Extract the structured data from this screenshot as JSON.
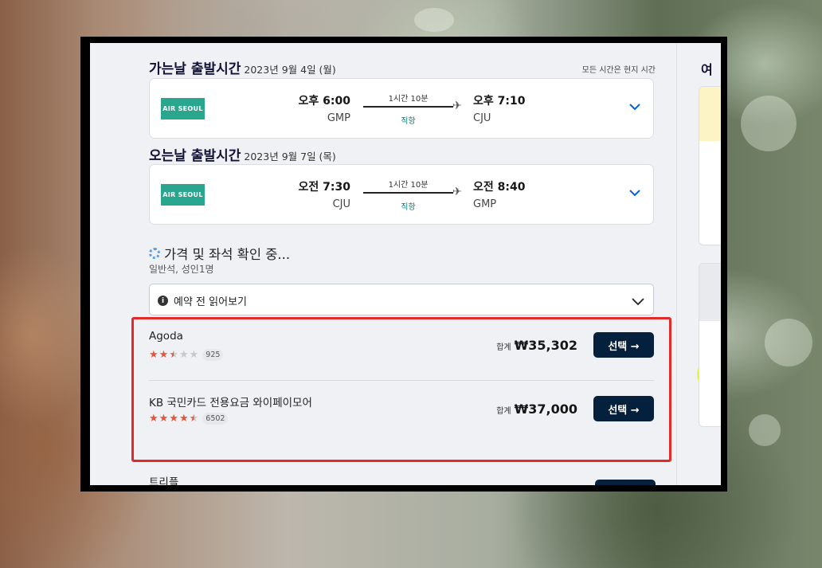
{
  "outbound": {
    "title": "가는날 출발시간",
    "date": "2023년 9월 4일 (월)",
    "note": "모든 시간은 현지 시간",
    "airline": "AIR SEOUL",
    "dep_time": "오후 6:00",
    "dep_code": "GMP",
    "arr_time": "오후 7:10",
    "arr_code": "CJU",
    "duration": "1시간 10분",
    "stops": "직항"
  },
  "inbound": {
    "title": "오는날 출발시간",
    "date": "2023년 9월 7일 (목)",
    "airline": "AIR SEOUL",
    "dep_time": "오전 7:30",
    "dep_code": "CJU",
    "arr_time": "오전 8:40",
    "arr_code": "GMP",
    "duration": "1시간 10분",
    "stops": "직항"
  },
  "status": {
    "loading": "가격 및 좌석 확인 중...",
    "cabin": "일반석, 성인1명"
  },
  "read_before": {
    "label": "예약 전 읽어보기"
  },
  "providers": [
    {
      "name": "Agoda",
      "rating": 2.5,
      "reviews": "925",
      "price_label": "합계",
      "price": "₩35,302",
      "button": "선택 →"
    },
    {
      "name": "KB 국민카드 전용요금 와이페이모어",
      "rating": 4.5,
      "reviews": "6502",
      "price_label": "합계",
      "price": "₩37,000",
      "button": "선택 →"
    },
    {
      "name": "트리플"
    }
  ],
  "sidebar": {
    "title": "여"
  },
  "colors": {
    "brand_dark": "#05203c",
    "highlight": "#e32a2a",
    "air_seoul": "#2aa68e",
    "star": "#e0573b"
  },
  "icons": {
    "chevron": "chevron-down-icon",
    "info": "info-icon",
    "plane": "plane-icon",
    "cursor": "hand-cursor-icon"
  }
}
